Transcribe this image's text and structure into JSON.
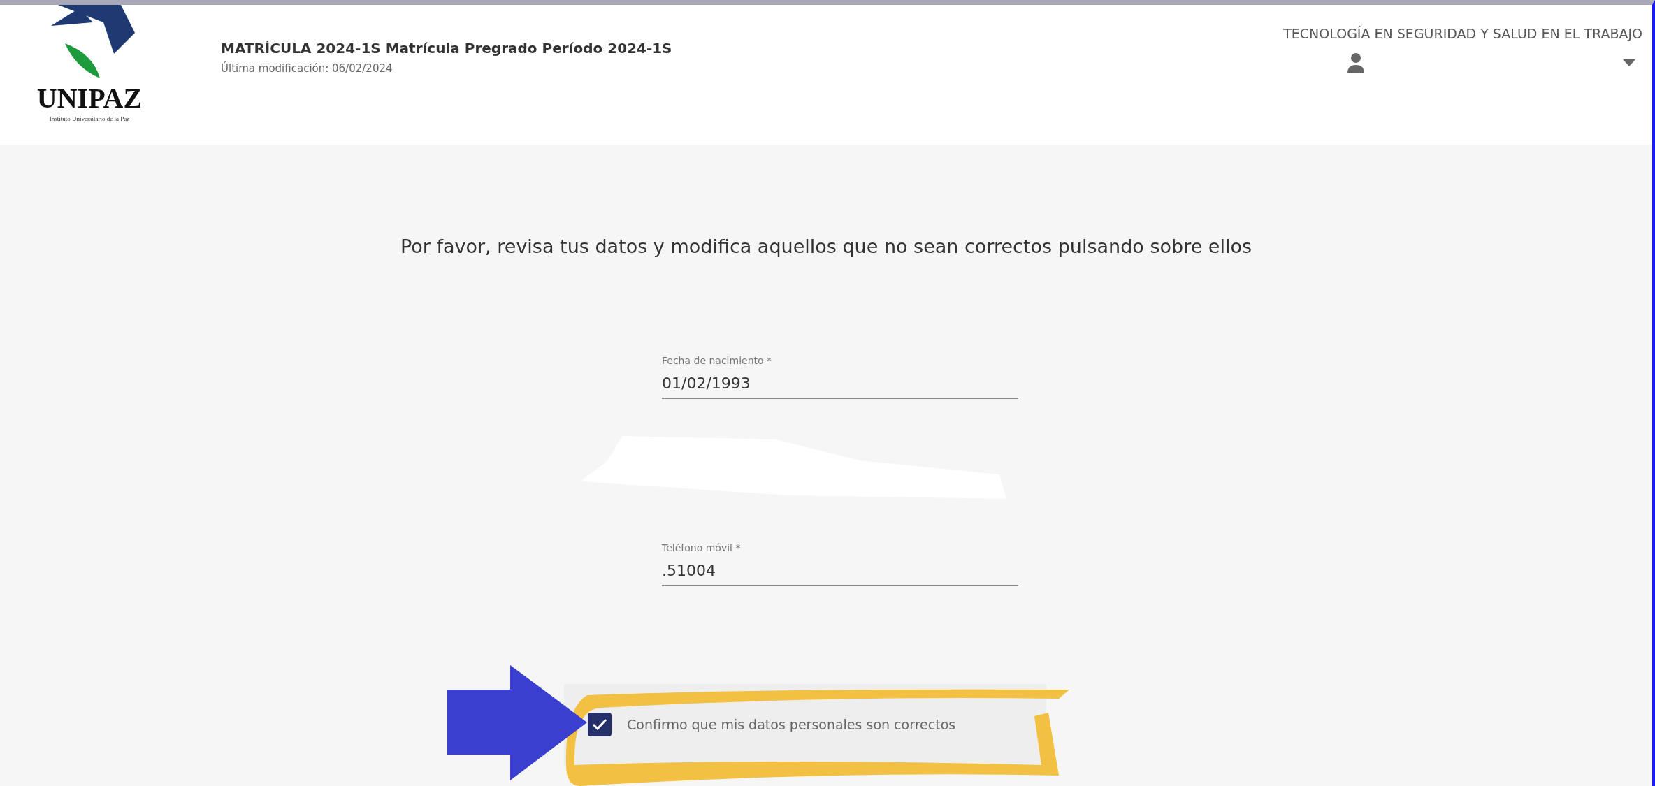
{
  "header": {
    "logo": {
      "name": "UNIPAZ",
      "tagline": "Instituto Universitario de la Paz"
    },
    "title_code": "MATRÍCULA 2024-1S",
    "title": "Matrícula Pregrado Período 2024-1S",
    "subtitle": "Última modificación: 06/02/2024",
    "program": "TECNOLOGÍA EN SEGURIDAD Y SALUD EN EL TRABAJO"
  },
  "instruction": "Por favor, revisa tus datos y modifica aquellos que no sean correctos pulsando sobre ellos",
  "fields": [
    {
      "label": "Fecha de nacimiento *",
      "value": "01/02/1993"
    },
    {
      "label": "Teléfono móvil *",
      "value": ".51004"
    }
  ],
  "confirm": {
    "label": "Confirmo que mis datos personales son correctos",
    "checked": true
  }
}
